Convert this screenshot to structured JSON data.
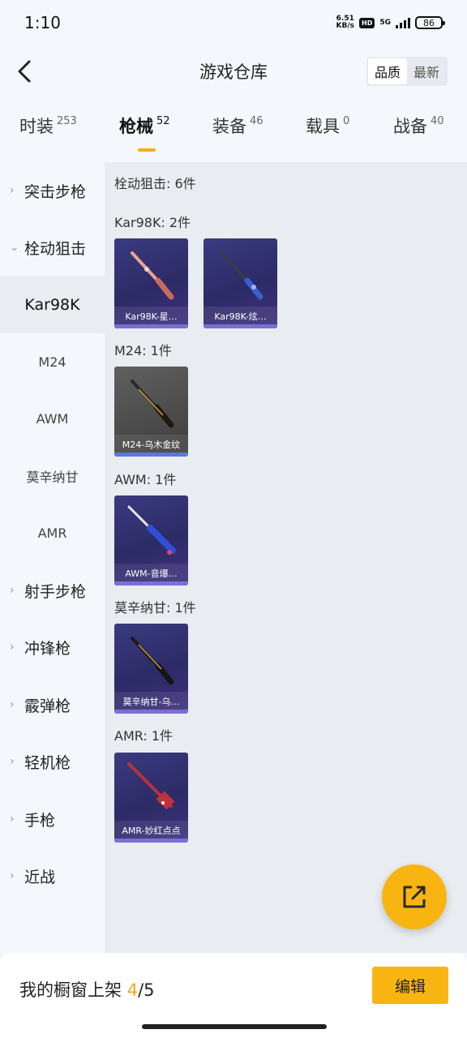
{
  "status": {
    "time": "1:10",
    "speed_value": "6.51",
    "speed_unit": "KB/s",
    "hd": "HD",
    "network": "5G",
    "battery": "86"
  },
  "header": {
    "title": "游戏仓库",
    "sort_options": [
      "品质",
      "最新"
    ]
  },
  "tabs": [
    {
      "label": "时装",
      "count": "253"
    },
    {
      "label": "枪械",
      "count": "52"
    },
    {
      "label": "装备",
      "count": "46"
    },
    {
      "label": "载具",
      "count": "0"
    },
    {
      "label": "战备",
      "count": "40"
    }
  ],
  "sidebar": {
    "items": [
      {
        "label": "突击步枪",
        "type": "category",
        "expanded": false
      },
      {
        "label": "栓动狙击",
        "type": "category",
        "expanded": true
      },
      {
        "label": "Kar98K",
        "type": "sub",
        "active": true
      },
      {
        "label": "M24",
        "type": "sub"
      },
      {
        "label": "AWM",
        "type": "sub"
      },
      {
        "label": "莫辛纳甘",
        "type": "sub"
      },
      {
        "label": "AMR",
        "type": "sub"
      },
      {
        "label": "射手步枪",
        "type": "category",
        "expanded": false
      },
      {
        "label": "冲锋枪",
        "type": "category",
        "expanded": false
      },
      {
        "label": "霰弹枪",
        "type": "category",
        "expanded": false
      },
      {
        "label": "轻机枪",
        "type": "category",
        "expanded": false
      },
      {
        "label": "手枪",
        "type": "category",
        "expanded": false
      },
      {
        "label": "近战",
        "type": "category",
        "expanded": false
      }
    ]
  },
  "content": {
    "summary": "栓动狙击: 6件",
    "groups": [
      {
        "title": "Kar98K: 2件",
        "items": [
          "Kar98K-星…",
          "Kar98K-炫…"
        ]
      },
      {
        "title": "M24: 1件",
        "items": [
          "M24-乌木金纹"
        ]
      },
      {
        "title": "AWM: 1件",
        "items": [
          "AWM-音爆…"
        ]
      },
      {
        "title": "莫辛纳甘: 1件",
        "items": [
          "莫辛纳甘-乌…"
        ]
      },
      {
        "title": "AMR: 1件",
        "items": [
          "AMR-妙红点点"
        ]
      }
    ]
  },
  "icons": {
    "back": "back-arrow-icon",
    "fab": "share-export-icon",
    "expand": "chevron-right-icon",
    "collapse": "chevron-down-icon"
  },
  "bottom": {
    "shelf_label": "我的橱窗上架",
    "shelf_current": "4",
    "shelf_total": "/5",
    "edit_label": "编辑"
  },
  "colors": {
    "accent": "#f8b512",
    "card_purple": "#2d2b66",
    "card_grey": "#4b4b4b"
  }
}
